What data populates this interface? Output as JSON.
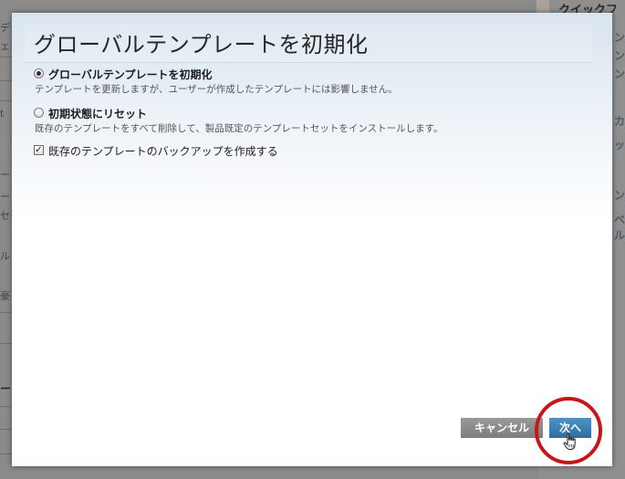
{
  "background": {
    "right_title": "クイックフ",
    "right_fragments": [
      "ン",
      "ン",
      "ン",
      "カ",
      "ッ",
      "ン",
      "ベル"
    ],
    "left_fragments": [
      "デュ",
      "ェー",
      "t",
      "ー",
      "ー",
      "セー",
      "ルト",
      "豪",
      "ート"
    ]
  },
  "dialog": {
    "title": "グローバルテンプレートを初期化",
    "options": [
      {
        "label": "グローバルテンプレートを初期化",
        "description": "テンプレートを更新しますが、ユーザーが作成したテンプレートには影響しません。",
        "checked": true
      },
      {
        "label": "初期状態にリセット",
        "description": "既存のテンプレートをすべて削除して、製品既定のテンプレートセットをインストールします。",
        "checked": false
      }
    ],
    "backup": {
      "label": "既存のテンプレートのバックアップを作成する",
      "checked": true
    },
    "buttons": {
      "cancel": "キャンセル",
      "next": "次へ"
    }
  },
  "colors": {
    "highlight_ring": "#c8141b",
    "next_button": "#2c6ea3",
    "cancel_button": "#7d7d7d"
  },
  "icons": {
    "cursor": "hand-pointer-icon"
  }
}
